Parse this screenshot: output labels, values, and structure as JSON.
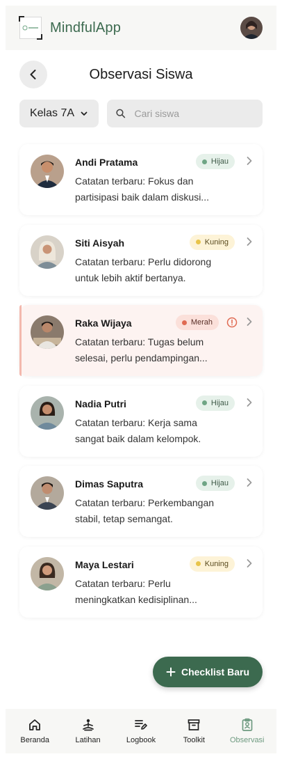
{
  "header": {
    "app_title": "MindfulApp"
  },
  "page": {
    "title": "Observasi Siswa"
  },
  "filters": {
    "class_label": "Kelas 7A",
    "search_placeholder": "Cari siswa"
  },
  "colors": {
    "primary": "#3c6a4f",
    "hijau_bg": "#e6f1ea",
    "hijau_dot": "#6fa585",
    "kuning_bg": "#fdf3d7",
    "kuning_dot": "#e8c44a",
    "merah_bg": "#fbe0da",
    "merah_dot": "#e06a52"
  },
  "students": [
    {
      "name": "Andi Pratama",
      "status": "Hijau",
      "note": "Catatan terbaru: Fokus dan partisipasi baik dalam diskusi..."
    },
    {
      "name": "Siti Aisyah",
      "status": "Kuning",
      "note": "Catatan terbaru: Perlu didorong untuk lebih aktif bertanya."
    },
    {
      "name": "Raka Wijaya",
      "status": "Merah",
      "note": "Catatan terbaru: Tugas belum selesai, perlu pendampingan..."
    },
    {
      "name": "Nadia Putri",
      "status": "Hijau",
      "note": "Catatan terbaru: Kerja sama sangat baik dalam kelompok."
    },
    {
      "name": "Dimas Saputra",
      "status": "Hijau",
      "note": "Catatan terbaru: Perkembangan stabil, tetap semangat."
    },
    {
      "name": "Maya Lestari",
      "status": "Kuning",
      "note": "Catatan terbaru: Perlu meningkatkan kedisiplinan..."
    }
  ],
  "fab": {
    "label": "Checklist Baru"
  },
  "nav": {
    "items": [
      {
        "label": "Beranda",
        "icon": "home-icon"
      },
      {
        "label": "Latihan",
        "icon": "meditation-icon"
      },
      {
        "label": "Logbook",
        "icon": "edit-list-icon"
      },
      {
        "label": "Toolkit",
        "icon": "archive-icon"
      },
      {
        "label": "Observasi",
        "icon": "clipboard-person-icon"
      }
    ]
  }
}
